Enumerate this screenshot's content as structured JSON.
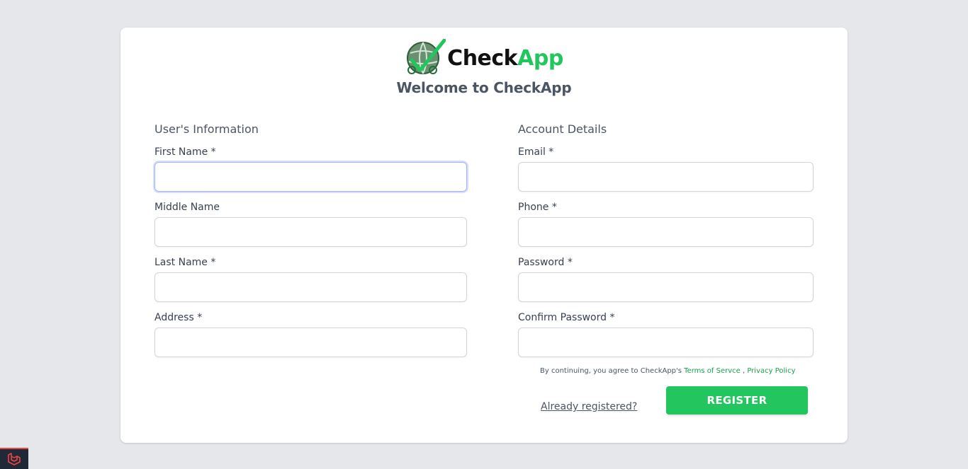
{
  "brand": {
    "name_part1": "Check",
    "name_part2": "App",
    "logo_icon": "globe-check-icon",
    "welcome": "Welcome to CheckApp"
  },
  "colors": {
    "accent": "#22c55e",
    "link": "#16a34a",
    "background": "#e5e7eb",
    "focus": "#a5b4fc"
  },
  "user_info": {
    "title": "User's Information",
    "fields": {
      "first_name": {
        "label": "First Name *",
        "value": ""
      },
      "middle_name": {
        "label": "Middle Name",
        "value": ""
      },
      "last_name": {
        "label": "Last Name *",
        "value": ""
      },
      "address": {
        "label": "Address *",
        "value": ""
      }
    }
  },
  "account": {
    "title": "Account Details",
    "fields": {
      "email": {
        "label": "Email *",
        "value": ""
      },
      "phone": {
        "label": "Phone *",
        "value": ""
      },
      "password": {
        "label": "Password *",
        "value": ""
      },
      "confirm_password": {
        "label": "Confirm Password *",
        "value": ""
      }
    }
  },
  "terms": {
    "prefix": "By continuing, you agree to CheckApp's ",
    "terms_link": "Terms of Servce",
    "separator": " , ",
    "privacy_link": "Privacy Policy"
  },
  "actions": {
    "already_registered": "Already registered?",
    "register": "REGISTER"
  },
  "debug_badge": {
    "icon": "laravel-icon"
  }
}
